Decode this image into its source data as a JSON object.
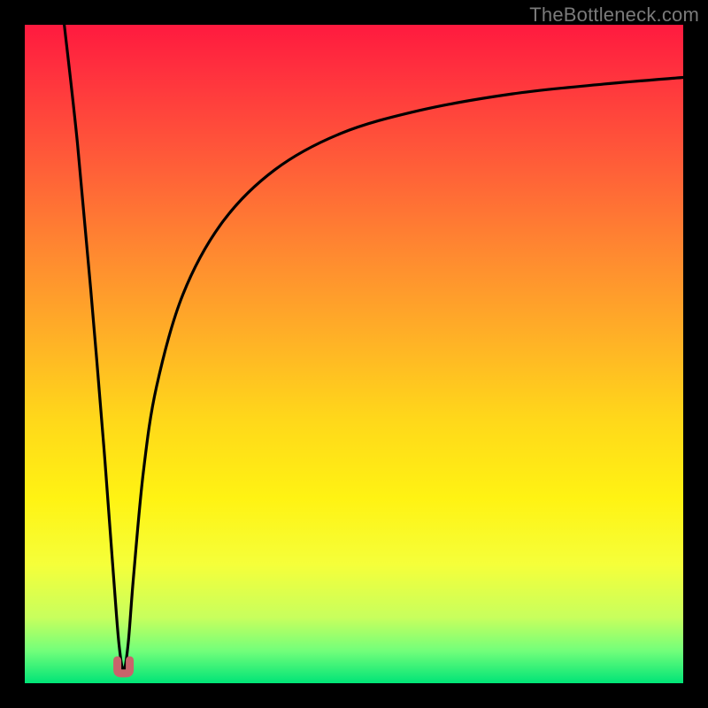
{
  "watermark": "TheBottleneck.com",
  "chart_data": {
    "type": "line",
    "title": "",
    "xlabel": "",
    "ylabel": "",
    "xlim": [
      0,
      100
    ],
    "ylim": [
      0,
      100
    ],
    "grid": false,
    "legend": false,
    "background_gradient": {
      "orientation": "vertical",
      "stops": [
        {
          "pos": 0.0,
          "color": "#ff1a3f"
        },
        {
          "pos": 0.35,
          "color": "#ff8a30"
        },
        {
          "pos": 0.6,
          "color": "#ffd81a"
        },
        {
          "pos": 0.82,
          "color": "#f5ff3a"
        },
        {
          "pos": 1.0,
          "color": "#00e477"
        }
      ]
    },
    "series": [
      {
        "name": "bottleneck-curve",
        "color": "#000000",
        "x": [
          6,
          8,
          10,
          12,
          13.5,
          14.3,
          15,
          15.7,
          16.5,
          18,
          20,
          24,
          30,
          38,
          48,
          60,
          74,
          88,
          100
        ],
        "y": [
          100,
          82,
          60,
          36,
          16,
          6,
          2,
          6,
          16,
          32,
          45,
          59,
          70,
          78,
          83.5,
          87,
          89.5,
          91,
          92
        ]
      }
    ],
    "cusp": {
      "x": 15,
      "y": 1.5,
      "marker_color": "#c9636b",
      "marker_shape": "u"
    }
  }
}
